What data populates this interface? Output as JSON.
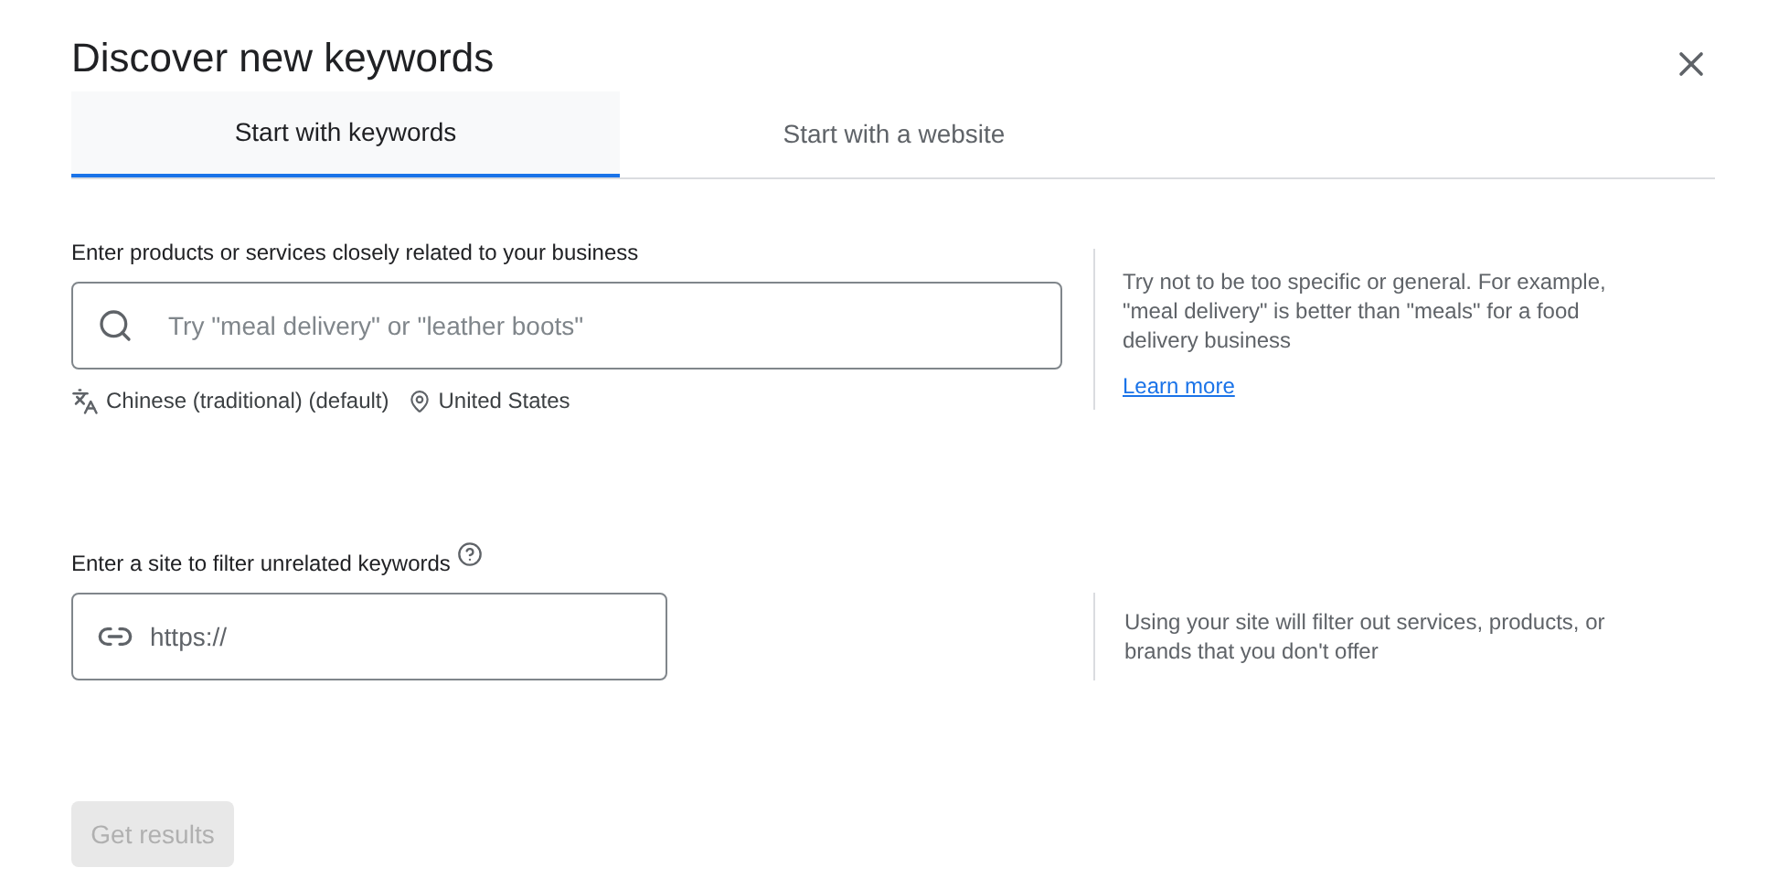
{
  "dialog": {
    "title": "Discover new keywords"
  },
  "tabs": [
    {
      "label": "Start with keywords",
      "selected": true
    },
    {
      "label": "Start with a website",
      "selected": false
    }
  ],
  "keywords_section": {
    "label": "Enter products or services closely related to your business",
    "placeholder": "Try \"meal delivery\" or \"leather boots\"",
    "language": "Chinese (traditional) (default)",
    "location": "United States",
    "help_text": "Try not to be too specific or general. For example, \"meal delivery\" is better than \"meals\" for a food delivery business",
    "help_link": "Learn more"
  },
  "site_section": {
    "label": "Enter a site to filter unrelated keywords",
    "placeholder": "https://",
    "help_text": "Using your site will filter out services, products, or brands that you don't offer"
  },
  "submit": {
    "label": "Get results",
    "disabled": true
  }
}
